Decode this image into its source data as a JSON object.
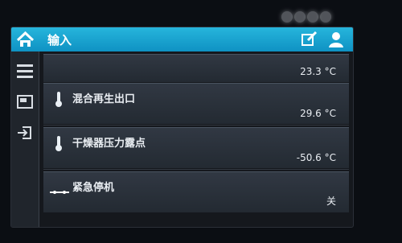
{
  "header": {
    "title": "输入"
  },
  "rows": [
    {
      "label": "",
      "value": "23.3 °C"
    },
    {
      "label": "混合再生出口",
      "value": "29.6 °C"
    },
    {
      "label": "干燥器压力露点",
      "value": "-50.6 °C"
    },
    {
      "label": "紧急停机",
      "value": "关"
    }
  ],
  "colors": {
    "header_blue": "#20a9d6",
    "background": "#15181d",
    "text": "#e9edf2"
  },
  "icons": {
    "home": "home-icon",
    "edit": "edit-icon",
    "user": "user-icon",
    "menu": "menu-icon",
    "screen": "screen-icon",
    "login": "login-icon",
    "thermometer": "thermometer-icon",
    "stop": "stop-line-icon"
  }
}
